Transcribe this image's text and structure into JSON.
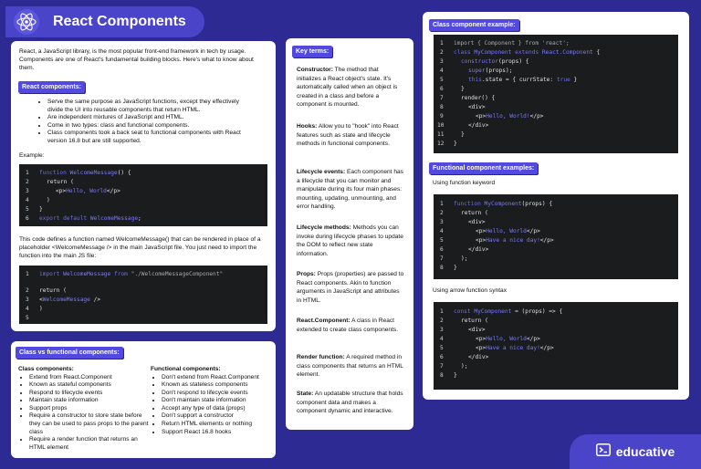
{
  "title": "React Components",
  "intro": "React, a JavaScript library, is the most popular front-end framework in tech by usage. Components are one of React's fundamental building blocks. Here's what to know about them.",
  "react_components": {
    "tag": "React components:",
    "bullets": [
      "Serve the same purpose as JavaScript functions, except they effectively divide the UI into reusable components that return HTML.",
      "Are independent mixtures of JavaScript and HTML.",
      "Come in two types: class and functional components.",
      "Class components took a back seat to functional components with React version 16.8 but are still supported."
    ],
    "example_label": "Example:",
    "import_text": "This code defines a function named WelcomeMessage() that can be rendered in place of a placeholder <WelcomeMessage /> in the main JavaScript file. You just need to import the function into the main JS file:"
  },
  "code1": {
    "line_numbers": [
      "1",
      "2",
      "3",
      "4",
      "5",
      "6"
    ],
    "l1_kw": "function",
    "l1_fn": "WelcomeMessage",
    "l1_rest": "() {",
    "l2": "return (",
    "l3_open": "<p>",
    "l3_text": "Hello, World",
    "l3_close": "</p>",
    "l4": ")",
    "l5": "}",
    "l6_kw": "export default",
    "l6_fn": "WelcomeMessage",
    "l6_rest": ";"
  },
  "code2": {
    "line_numbers": [
      "1",
      "2",
      "3",
      "4",
      "5"
    ],
    "l1_kw": "import",
    "l1_fn": "WelcomeMessage",
    "l1_from": "from",
    "l1_str": "\"./WelcomeMessageComponent\"",
    "l3": "return (",
    "l4_open": "<",
    "l4_fn": "WelcomeMessage",
    "l4_close": " />",
    "l5": ")"
  },
  "class_vs_functional": {
    "tag": "Class vs functional components:",
    "class_heading": "Class components:",
    "class_items": [
      "Extend from React.Component",
      "Known as stateful components",
      "Respond to lifecycle events",
      "Maintain state information",
      "Support props",
      "Require a constructor to store state before they can be used to pass props to the parent class",
      "Require a render function that returns an HTML element"
    ],
    "functional_heading": "Functional components:",
    "functional_items": [
      "Don't extend from React.Component",
      "Known as stateless components",
      "Don't respond to lifecycle events",
      "Don't maintain state information",
      "Accept any type of data (props)",
      "Don't support a constructor",
      "Return HTML elements or nothing",
      "Support React 16.8 hooks"
    ]
  },
  "key_terms": {
    "tag": "Key terms:",
    "items": [
      {
        "term": "Constructor:",
        "def": "The method that initializes a React object's state. It's automatically called when an object is created in a class and before a component is mounted."
      },
      {
        "term": "Hooks:",
        "def": "Allow you to \"hook\" into React features such as state and lifecycle methods in functional components."
      },
      {
        "term": "Lifecycle events:",
        "def": "Each component has a lifecycle that you can monitor and manipulate during its four main phases: mounting, updating, unmounting, and error handling."
      },
      {
        "term": "Lifecycle methods:",
        "def": "Methods you can invoke during lifecycle phases to update the DOM to reflect new state information."
      },
      {
        "term": "Props:",
        "def": "Props (properties) are passed to React components. Akin to function arguments in JavaScript and attributes in HTML."
      },
      {
        "term": "React.Component:",
        "def": "A class in React extended to create class components."
      },
      {
        "term": "Render function:",
        "def": "A required method in class components that returns an HTML element."
      },
      {
        "term": "State:",
        "def": "An updatable structure that holds component data and makes a component dynamic and interactive."
      }
    ]
  },
  "class_example": {
    "tag": "Class component example:",
    "line_numbers": [
      "1",
      "2",
      "3",
      "4",
      "5",
      "6",
      "7",
      "8",
      "9",
      "10",
      "11",
      "12"
    ],
    "l1": "import { Component } from 'react';",
    "l2_kw": "class",
    "l2_fn": "MyComponent",
    "l2_ext": "extends",
    "l2_cls": "React.Component",
    "l2_rest": " {",
    "l3_fn": "constructor",
    "l3_rest": "(props) {",
    "l4_fn": "super",
    "l4_rest": "(props);",
    "l5_kw": "this",
    "l5_rest": ".state = { currState: ",
    "l5_val": "true",
    "l5_end": " }",
    "l6": "}",
    "l7": "render() {",
    "l8": "<div>",
    "l9_open": "<p>",
    "l9_text": "Hello, World!",
    "l9_close": "</p>",
    "l10": "</div>",
    "l11": "}",
    "l12": "}"
  },
  "functional_examples": {
    "tag": "Functional component examples:",
    "keyword_label": "Using function keyword",
    "arrow_label": "Using arrow function syntax",
    "f1": {
      "line_numbers": [
        "1",
        "2",
        "3",
        "4",
        "5",
        "6",
        "7",
        "8"
      ],
      "l1_kw": "function",
      "l1_fn": "MyComponent",
      "l1_rest": "(props) {",
      "l2": "return (",
      "l3": "<div>",
      "l4_open": "<p>",
      "l4_text": "Hello, World",
      "l4_close": "</p>",
      "l5_open": "<p>",
      "l5_text": "Have a nice day!",
      "l5_close": "</p>",
      "l6": "</div>",
      "l7": ");",
      "l8": "}"
    },
    "f2": {
      "line_numbers": [
        "1",
        "2",
        "3",
        "4",
        "5",
        "6",
        "7",
        "8"
      ],
      "l1_kw": "const",
      "l1_fn": "MyComponent",
      "l1_rest": " = (props) => {",
      "l2": "return (",
      "l3": "<div>",
      "l4_open": "<p>",
      "l4_text": "Hello, World",
      "l4_close": "</p>",
      "l5_open": "<p>",
      "l5_text": "Have a nice day!",
      "l5_close": "</p>",
      "l6": "</div>",
      "l7": ");",
      "l8": "}"
    }
  },
  "brand": "educative",
  "icons": [
    "react-logo-icon",
    "educative-logo-icon"
  ]
}
